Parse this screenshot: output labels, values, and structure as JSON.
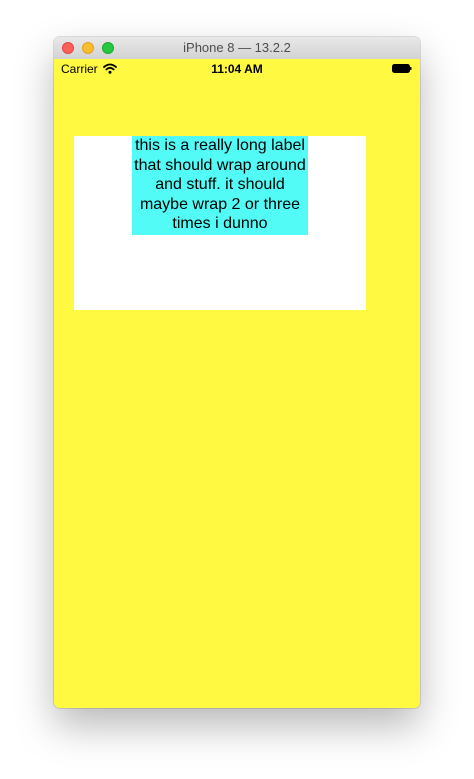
{
  "window": {
    "title": "iPhone 8 — 13.2.2"
  },
  "status_bar": {
    "carrier": "Carrier",
    "time": "11:04 AM",
    "icons": [
      "wifi-icon",
      "battery-icon"
    ]
  },
  "content": {
    "label_text": "this is a really long label that should wrap around and stuff. it should maybe wrap 2 or three times i dunno"
  },
  "colors": {
    "screen_background": "#fff941",
    "container_background": "#ffffff",
    "label_background": "#52fbf5"
  }
}
